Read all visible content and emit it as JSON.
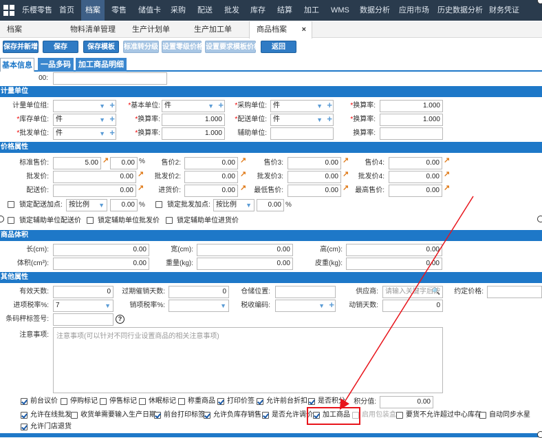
{
  "topnav": {
    "items": [
      "乐樱零售",
      "首页",
      "档案",
      "零售",
      "储值卡",
      "采购",
      "配送",
      "批发",
      "库存",
      "结算",
      "加工",
      "WMS",
      "数据分析",
      "应用市场",
      "历史数据分析",
      "财务凭证"
    ],
    "active_index": 2
  },
  "tabs": [
    {
      "label": "档案"
    },
    {
      "label": "物料清单管理"
    },
    {
      "label": "生产计划单"
    },
    {
      "label": "生产加工单"
    },
    {
      "label": "商品档案",
      "close": "×"
    }
  ],
  "toolbar": [
    "保存并新增",
    "保存",
    "保存模板",
    "标准转分级",
    "设置零级价格",
    "设置要求模板价格",
    "返回"
  ],
  "subtabs": [
    "基本信息",
    "一品多码",
    "加工商品明细"
  ],
  "top_field_label": "00:",
  "sections": {
    "unit": "计量单位",
    "price": "价格属性",
    "volume": "商品体积",
    "other": "其他属性"
  },
  "unit": {
    "group_label": "计量单位组:",
    "base_label": "基本单位:",
    "base_value": "件",
    "purchase_label": "采购单位:",
    "purchase_value": "件",
    "rate_label": "换算率:",
    "rate1": "1.000",
    "stock_label": "库存单位:",
    "stock_value": "件",
    "rate2": "1.000",
    "dist_label": "配送单位:",
    "dist_value": "件",
    "rate3": "1.000",
    "whole_label": "批发单位:",
    "whole_value": "件",
    "rate4": "1.000",
    "aux_label": "辅助单位:"
  },
  "price": {
    "std_label": "标准售价:",
    "std_value": "5.00",
    "std_pct": "0.00",
    "pct": "%",
    "p2_label": "售价2:",
    "p2": "0.00",
    "p3_label": "售价3:",
    "p3": "0.00",
    "p4_label": "售价4:",
    "p4": "0.00",
    "w_label": "批发价:",
    "w": "0.00",
    "w2_label": "批发价2:",
    "w2": "0.00",
    "w3_label": "批发价3:",
    "w3": "0.00",
    "w4_label": "批发价4:",
    "w4": "0.00",
    "d_label": "配送价:",
    "d": "0.00",
    "in_label": "进货价:",
    "in": "0.00",
    "min_label": "最低售价:",
    "min": "0.00",
    "max_label": "最高售价:",
    "max": "0.00",
    "lock_dist": "锁定配送加点:",
    "lock_dist_mode": "按比例",
    "lock_dist_val": "0.00",
    "lock_whole": "锁定批发加点:",
    "lock_whole_mode": "按比例",
    "lock_whole_val": "0.00",
    "lock_aux_dist": "锁定辅助单位配送价",
    "lock_aux_whole": "锁定辅助单位批发价",
    "lock_aux_in": "锁定辅助单位进货价"
  },
  "volume": {
    "len_label": "长(cm):",
    "len": "0.00",
    "wid_label": "宽(cm):",
    "wid": "0.00",
    "hei_label": "高(cm):",
    "hei": "0.00",
    "vol_label": "体积(cm³):",
    "vol": "0.00",
    "wt_label": "重量(kg):",
    "wt": "0.00",
    "skin_label": "皮重(kg):",
    "skin": "0.00"
  },
  "other": {
    "valid_label": "有效天数:",
    "valid": "0",
    "expire_label": "过期催销天数:",
    "expire": "0",
    "loc_label": "仓储位置:",
    "supplier_label": "供应商:",
    "supplier_ph": "请输入关键字后按",
    "contract_label": "约定价格:",
    "intax_label": "进项税率%:",
    "intax": "7",
    "outtax_label": "销项税率%:",
    "taxcode_label": "税收编码:",
    "movedays_label": "动销天数:",
    "movedays": "0",
    "barcode_label": "条码秤标签号:",
    "help": "?",
    "note_label": "注意事项:",
    "note_ph": "注意事项(可以针对不同行业设置商品的相关注意事项)"
  },
  "checks_row1": [
    {
      "label": "前台议价",
      "on": true
    },
    {
      "label": "停购标记",
      "on": false
    },
    {
      "label": "停售标记",
      "on": false
    },
    {
      "label": "休眠标记",
      "on": false
    },
    {
      "label": "称重商品",
      "on": false
    },
    {
      "label": "打印价签",
      "on": true
    },
    {
      "label": "允许前台折扣",
      "on": true
    },
    {
      "label": "是否积分",
      "on": true
    }
  ],
  "points_label": "积分值:",
  "points_value": "0.00",
  "checks_row2": [
    {
      "label": "允许在线批发",
      "on": true
    },
    {
      "label": "收货单需要输入生产日期",
      "on": false
    },
    {
      "label": "前台打印标签",
      "on": true
    },
    {
      "label": "允许负库存销售",
      "on": true
    },
    {
      "label": "是否允许调价",
      "on": true
    },
    {
      "label": "加工商品",
      "on": true
    },
    {
      "label": "启用包装盒",
      "on": false
    },
    {
      "label": "要货不允许超过中心库存",
      "on": false
    },
    {
      "label": "自动同步水星",
      "on": false
    }
  ],
  "checks_row3": [
    {
      "label": "允许门店退货",
      "on": true
    }
  ],
  "colors": {
    "nav": "#2a3b4d",
    "accent": "#1e78c8",
    "button": "#2f7bc4",
    "highlight": "#e8141b"
  }
}
